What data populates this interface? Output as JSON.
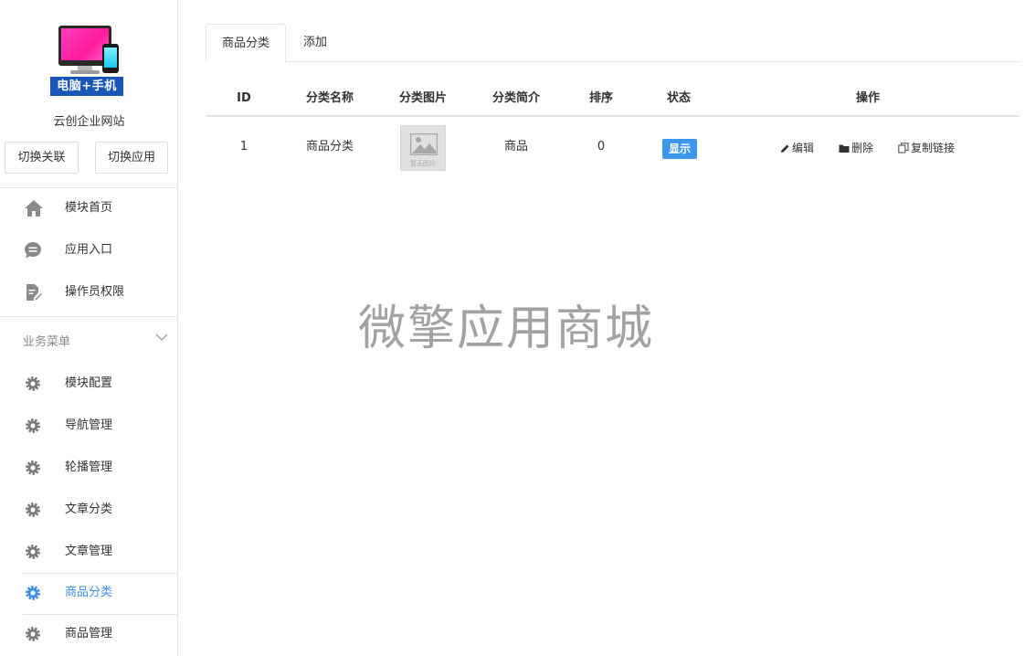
{
  "sidebar": {
    "logo_text": "电脑+手机",
    "site_name": "云创企业网站",
    "switch_buttons": [
      "切换关联",
      "切换应用"
    ],
    "top_items": [
      {
        "label": "模块首页",
        "icon": "home-icon"
      },
      {
        "label": "应用入口",
        "icon": "chat-icon"
      },
      {
        "label": "操作员权限",
        "icon": "document-edit-icon"
      }
    ],
    "section_title": "业务菜单",
    "menu_items": [
      {
        "label": "模块配置",
        "icon": "gear-icon"
      },
      {
        "label": "导航管理",
        "icon": "gear-icon"
      },
      {
        "label": "轮播管理",
        "icon": "gear-icon"
      },
      {
        "label": "文章分类",
        "icon": "gear-icon"
      },
      {
        "label": "文章管理",
        "icon": "gear-icon"
      },
      {
        "label": "商品分类",
        "icon": "gear-icon",
        "active": true
      },
      {
        "label": "商品管理",
        "icon": "gear-icon"
      }
    ],
    "active_color": "#3a8ee6"
  },
  "tabs": [
    "商品分类",
    "添加"
  ],
  "table": {
    "headers": [
      "ID",
      "分类名称",
      "分类图片",
      "分类简介",
      "排序",
      "状态",
      "操作"
    ],
    "rows": [
      {
        "id": "1",
        "name": "商品分类",
        "image_caption": "暂无图片",
        "intro": "商品",
        "sort": "0",
        "status": "显示",
        "actions": [
          "编辑",
          "删除",
          "复制链接"
        ]
      }
    ]
  },
  "watermark": "微擎应用商城",
  "colors": {
    "badge": "#3c98ec",
    "logo_banner": "#1a56b8",
    "gear": "#7a7a7a"
  }
}
